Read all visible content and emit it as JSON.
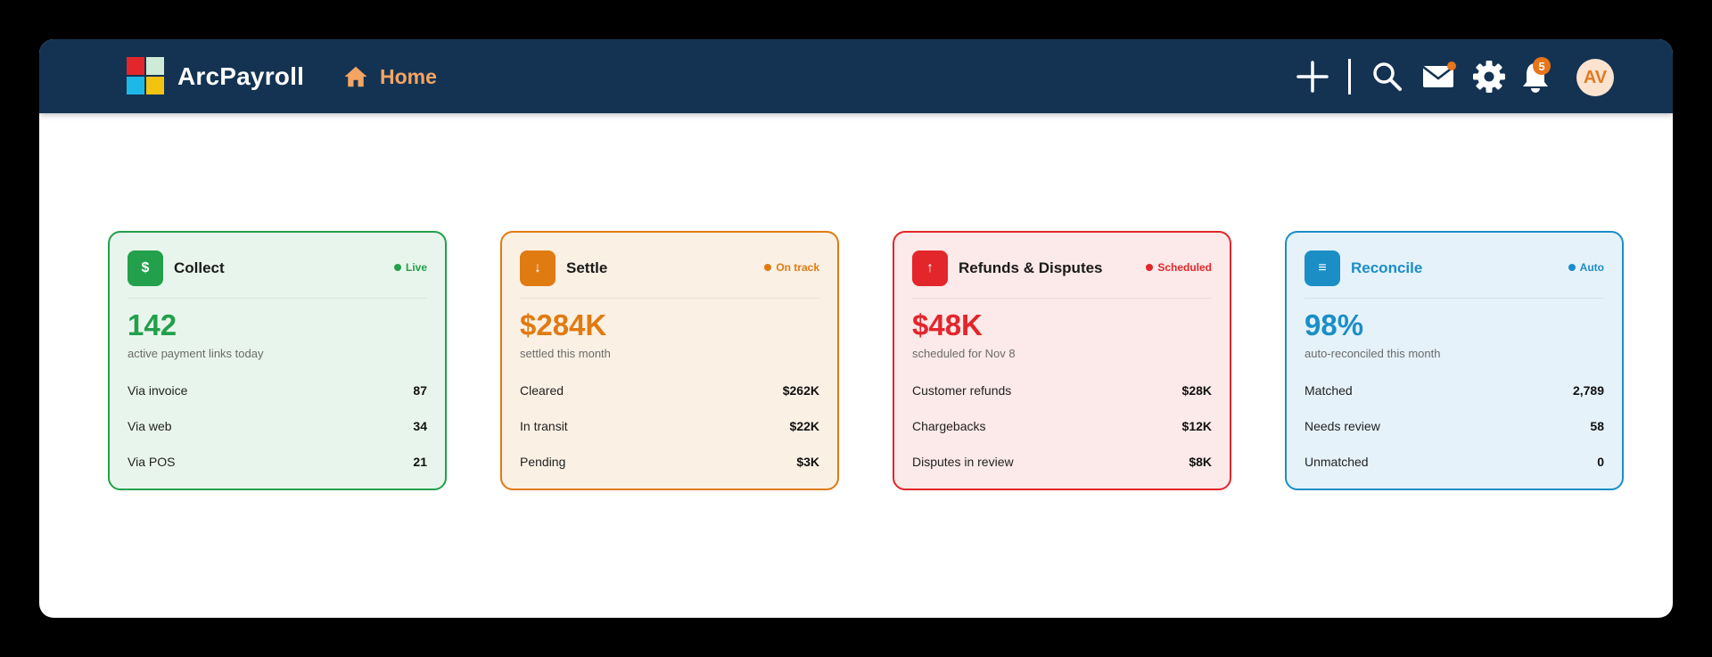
{
  "header": {
    "brand": "ArcPayroll",
    "nav_home": "Home",
    "notification_count": "5",
    "avatar_initials": "AV",
    "icons": [
      "plus-icon",
      "search-icon",
      "mail-icon",
      "gear-icon",
      "bell-icon"
    ],
    "colors": {
      "bar": "#143352",
      "home": "#F5A563",
      "badge": "#E8751A"
    }
  },
  "cards": [
    {
      "title": "Collect",
      "icon": "$",
      "status": "Live",
      "metric": "142",
      "sub": "active payment links today",
      "rows": [
        {
          "label": "Via invoice",
          "value": "87"
        },
        {
          "label": "Via web",
          "value": "34"
        },
        {
          "label": "Via POS",
          "value": "21"
        }
      ],
      "accent": "#22A04B",
      "bg": "#E8F5EC"
    },
    {
      "title": "Settle",
      "icon": "↓",
      "status": "On track",
      "metric": "$284K",
      "sub": "settled this month",
      "rows": [
        {
          "label": "Cleared",
          "value": "$262K"
        },
        {
          "label": "In transit",
          "value": "$22K"
        },
        {
          "label": "Pending",
          "value": "$3K"
        }
      ],
      "accent": "#E07B12",
      "bg": "#FBF0E4"
    },
    {
      "title": "Refunds & Disputes",
      "icon": "↑",
      "status": "Scheduled",
      "metric": "$48K",
      "sub": "scheduled for Nov 8",
      "rows": [
        {
          "label": "Customer refunds",
          "value": "$28K"
        },
        {
          "label": "Chargebacks",
          "value": "$12K"
        },
        {
          "label": "Disputes in review",
          "value": "$8K"
        }
      ],
      "accent": "#E2262B",
      "bg": "#FCE9E9"
    },
    {
      "title": "Reconcile",
      "icon": "≡",
      "status": "Auto",
      "metric": "98%",
      "sub": "auto-reconciled this month",
      "rows": [
        {
          "label": "Matched",
          "value": "2,789"
        },
        {
          "label": "Needs review",
          "value": "58"
        },
        {
          "label": "Unmatched",
          "value": "0"
        }
      ],
      "accent": "#1B8EC6",
      "bg": "#E5F2FA"
    }
  ]
}
